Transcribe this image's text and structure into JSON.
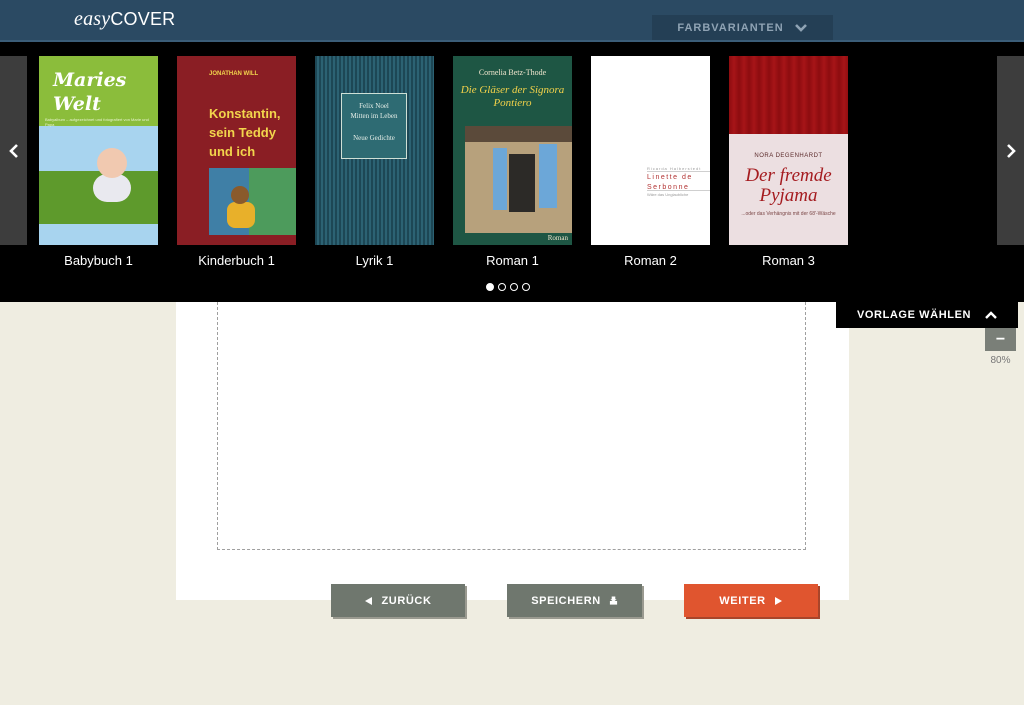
{
  "header": {
    "logo_easy": "easy",
    "logo_cover": "COVER",
    "variants_label": "FARBVARIANTEN"
  },
  "gallery": {
    "templates": [
      {
        "label": "Babybuch 1",
        "cover_title": "Maries Welt",
        "cover_subtitle": "Babyalbum – aufgezeichnet und fotografiert von Marie und Papa"
      },
      {
        "label": "Kinderbuch 1",
        "cover_author": "JONATHAN WILL",
        "cover_title": "Konstantin, sein Teddy und ich"
      },
      {
        "label": "Lyrik 1",
        "cover_author": "Felix Noel",
        "cover_title": "Mitten im Leben",
        "cover_subtitle": "Neue Gedichte"
      },
      {
        "label": "Roman 1",
        "cover_author": "Cornelia Betz-Thode",
        "cover_title": "Die Gläser der Signora Pontiero",
        "cover_genre": "Roman"
      },
      {
        "label": "Roman 2",
        "cover_author": "Ricarda Halberstedt",
        "cover_title": "Linette de Serbonne",
        "cover_subtitle": "Wäre das Unglaubliche"
      },
      {
        "label": "Roman 3",
        "cover_author": "NORA DEGENHARDT",
        "cover_title": "Der fremde Pyjama",
        "cover_subtitle": "...oder das Verhängnis mit der 68'-Wäsche"
      }
    ],
    "pages": 4,
    "active_page": 1
  },
  "panel": {
    "vorlage_label": "VORLAGE WÄHLEN"
  },
  "zoom": {
    "minus": "−",
    "value": "80%"
  },
  "footer": {
    "back_label": "ZURÜCK",
    "save_label": "SPEICHERN",
    "next_label": "WEITER"
  },
  "colors": {
    "header_bg": "#2b4a63",
    "page_bg": "#efede1",
    "button_gray": "#6f776e",
    "button_accent": "#e0552f"
  }
}
